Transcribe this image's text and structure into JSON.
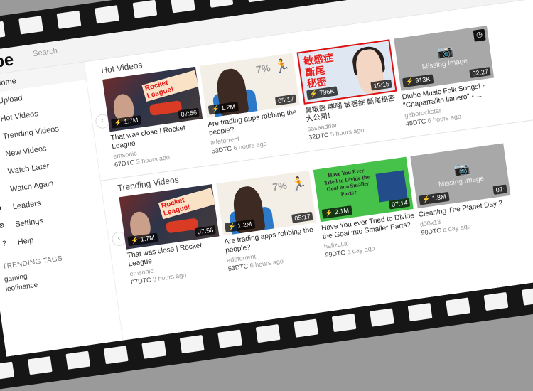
{
  "app": {
    "logo": "Dtube",
    "search_placeholder": "Search"
  },
  "sidebar": {
    "items": [
      {
        "label": "Home",
        "icon": "home-icon",
        "glyph": "⌂",
        "active": true
      },
      {
        "label": "Upload",
        "icon": "upload-icon",
        "glyph": "⇪"
      },
      {
        "label": "Hot Videos",
        "icon": "fire-icon",
        "glyph": "♨"
      },
      {
        "label": "Trending Videos",
        "icon": "trophy-icon",
        "glyph": "♕"
      },
      {
        "label": "New Videos",
        "icon": "hourglass-icon",
        "glyph": "⧗"
      },
      {
        "label": "Watch Later",
        "icon": "clock-icon",
        "glyph": "◷"
      },
      {
        "label": "Watch Again",
        "icon": "history-icon",
        "glyph": "↺"
      },
      {
        "label": "Leaders",
        "icon": "users-icon",
        "glyph": "☻"
      },
      {
        "label": "Settings",
        "icon": "gear-icon",
        "glyph": "⚙"
      },
      {
        "label": "Help",
        "icon": "help-icon",
        "glyph": "?"
      }
    ],
    "tags_title": "TRENDING TAGS",
    "tags": [
      "gaming",
      "leofinance"
    ]
  },
  "hot": {
    "title": "Hot Videos",
    "videos": [
      {
        "title": "That was close | Rocket League",
        "author": "emsonic",
        "payout": "67DTC",
        "ago": "3 hours ago",
        "views": "⚡ 1.7M",
        "duration": "07:56"
      },
      {
        "title": "Are trading apps robbing the people?",
        "author": "adetorrent",
        "payout": "53DTC",
        "ago": "6 hours ago",
        "views": "⚡ 1.2M",
        "duration": "05:17"
      },
      {
        "title": "鼻敏感 哮喘 敏感症 斷尾秘密大公開！",
        "author": "sasaadrian",
        "payout": "32DTC",
        "ago": "5 hours ago",
        "views": "⚡ 796K",
        "duration": "15:15"
      },
      {
        "title": "Dtube Music Folk Songs! - \"Chaparralito llanero\" - ...",
        "author": "gaborockstar",
        "payout": "45DTC",
        "ago": "6 hours ago",
        "views": "⚡ 913K",
        "duration": "02:27",
        "missing": "Missing Image"
      }
    ]
  },
  "trending": {
    "title": "Trending Videos",
    "videos": [
      {
        "title": "That was close | Rocket League",
        "author": "emsonic",
        "payout": "67DTC",
        "ago": "3 hours ago",
        "views": "⚡ 1.7M",
        "duration": "07:56"
      },
      {
        "title": "Are trading apps robbing the people?",
        "author": "adetorrent",
        "payout": "53DTC",
        "ago": "6 hours ago",
        "views": "⚡ 1.2M",
        "duration": "05:17"
      },
      {
        "title": "Have You ever Tried to Divide the Goal into Smaller Parts?",
        "author": "hafizullah",
        "payout": "99DTC",
        "ago": "a day ago",
        "views": "⚡ 2.1M",
        "duration": "07:14",
        "thumb_text": "Have You Ever Tried to Divide the Goal into Smaller Parts?"
      },
      {
        "title": "Cleaning The Planet Day 2",
        "author": "d00k13",
        "payout": "90DTC",
        "ago": "a day ago",
        "views": "⚡ 1.8M",
        "duration": "07:",
        "missing": "Missing Image"
      }
    ]
  },
  "thumb_text": {
    "rocket": "Rocket League!",
    "pct": "7%",
    "zh": "敏感症\n斷尾\n秘密"
  },
  "colors": {
    "accent": "#e41616",
    "film": "#161616"
  }
}
